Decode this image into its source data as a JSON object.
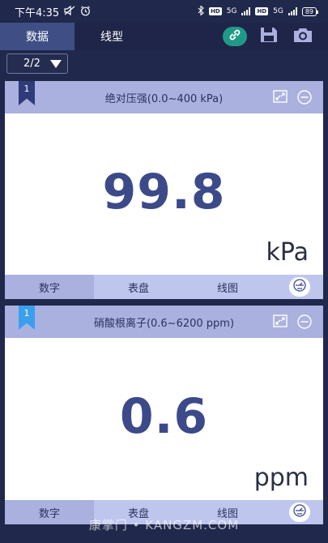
{
  "status_bar": {
    "time": "下午4:35",
    "network_1": "5G",
    "network_2": "5G",
    "battery": "89"
  },
  "top_tabs": {
    "tabs": [
      {
        "label": "数据",
        "active": true
      },
      {
        "label": "线型",
        "active": false
      }
    ],
    "accent_color": "#1f9a86"
  },
  "page_selector": {
    "value": "2/2"
  },
  "cards": [
    {
      "badge_number": "1",
      "title": "绝对压强(0.0~400 kPa)",
      "value": "99.8",
      "unit": "kPa",
      "footer_tabs": [
        {
          "label": "数字",
          "active": true
        },
        {
          "label": "表盘",
          "active": false
        },
        {
          "label": "线图",
          "active": false
        }
      ]
    },
    {
      "badge_number": "1",
      "title": "硝酸根离子(0.6~6200 ppm)",
      "value": "0.6",
      "unit": "ppm",
      "footer_tabs": [
        {
          "label": "数字",
          "active": true
        },
        {
          "label": "表盘",
          "active": false
        },
        {
          "label": "线图",
          "active": false
        }
      ]
    }
  ],
  "watermark": "康掌门 • KANGZM.COM"
}
